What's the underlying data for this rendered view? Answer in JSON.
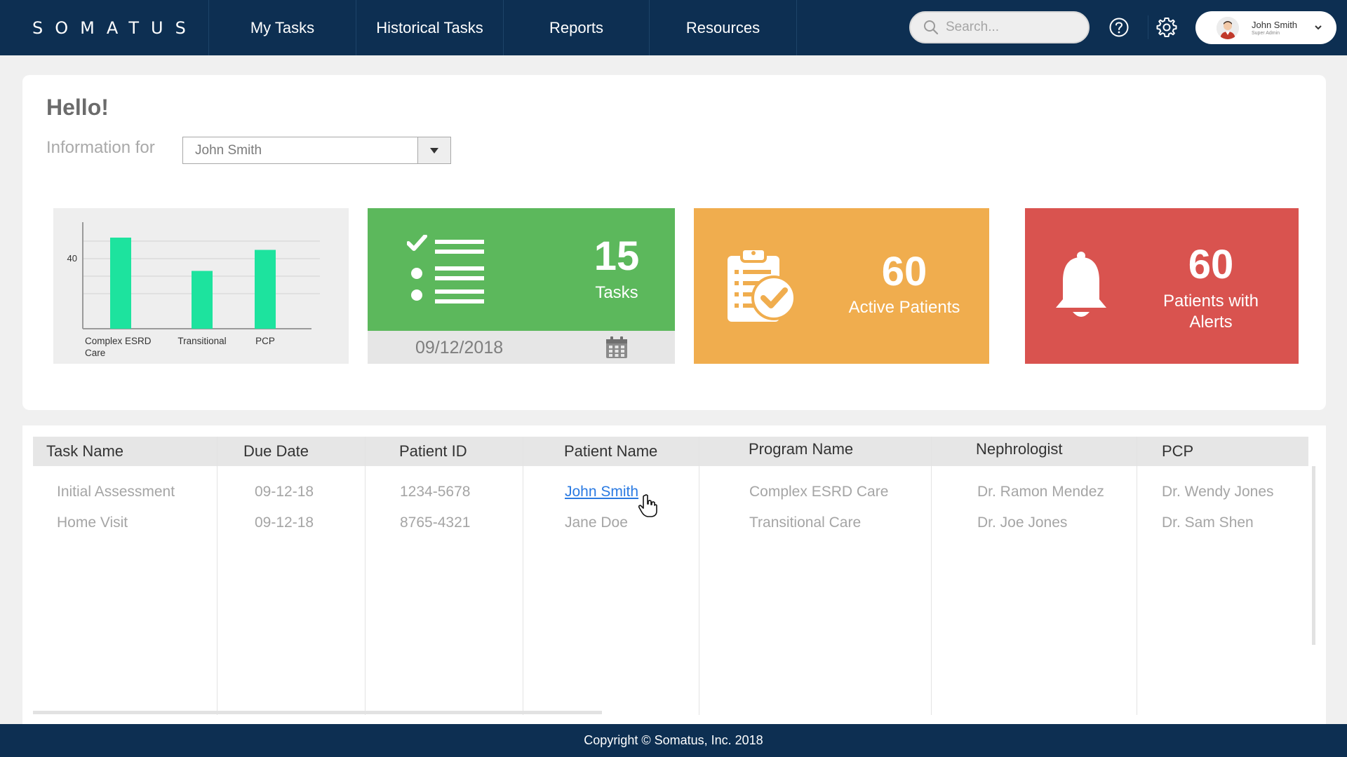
{
  "app": {
    "logo": "SOMATUS",
    "nav": [
      "My Tasks",
      "Historical Tasks",
      "Reports",
      "Resources"
    ],
    "search_placeholder": "Search...",
    "user": {
      "name": "John Smith",
      "role": "Super Admin"
    }
  },
  "greeting": "Hello!",
  "info_for_label": "Information for",
  "info_for_selected": "John Smith",
  "chart_data": {
    "type": "bar",
    "categories": [
      "Complex ESRD Care",
      "Transitional",
      "PCP"
    ],
    "values": [
      52,
      33,
      45
    ],
    "ylim": [
      0,
      60
    ],
    "yticks": [
      40
    ],
    "grid": true,
    "bar_color": "#1de39e",
    "title": "",
    "xlabel": "",
    "ylabel": ""
  },
  "tiles": {
    "tasks": {
      "count": "15",
      "label": "Tasks",
      "date": "09/12/2018",
      "color": "#5cb85c"
    },
    "active_patients": {
      "count": "60",
      "label": "Active Patients",
      "color": "#f0ad4e"
    },
    "alerts": {
      "count": "60",
      "label_line1": "Patients with",
      "label_line2": "Alerts",
      "color": "#d9534f"
    }
  },
  "table": {
    "headers": [
      "Task Name",
      "Due Date",
      "Patient ID",
      "Patient Name",
      "Program Name",
      "Nephrologist",
      "PCP"
    ],
    "rows": [
      [
        "Initial Assessment",
        "09-12-18",
        "1234-5678",
        "John Smith",
        "Complex ESRD Care",
        "Dr. Ramon Mendez",
        "Dr. Wendy Jones"
      ],
      [
        "Home Visit",
        "09-12-18",
        "8765-4321",
        "Jane Doe",
        "Transitional Care",
        "Dr. Joe Jones",
        "Dr. Sam Shen"
      ]
    ]
  },
  "footer": "Copyright © Somatus, Inc. 2018"
}
